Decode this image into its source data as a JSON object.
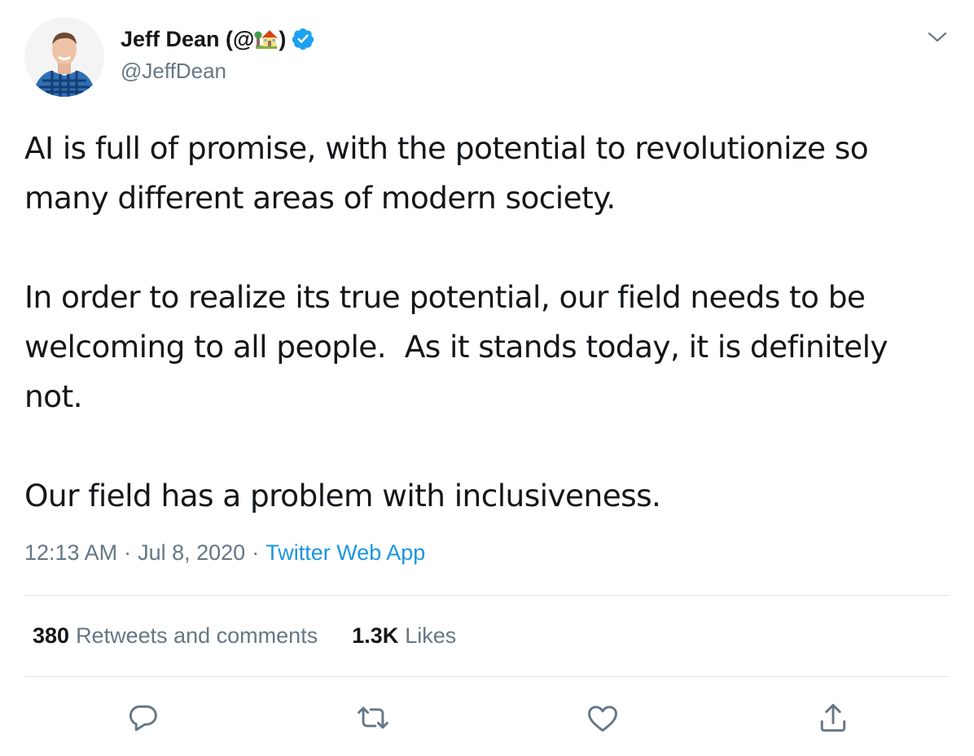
{
  "author": {
    "display_name_prefix": "Jeff Dean (@",
    "display_name_suffix": ")",
    "handle": "@JeffDean",
    "verified": true
  },
  "tweet": {
    "paragraphs": [
      "AI is full of promise, with the potential to revolutionize so many different areas of modern society.",
      "In order to realize its true potential, our field needs to be welcoming to all people.  As it stands today, it is definitely not.",
      "Our field has a problem with inclusiveness."
    ],
    "time": "12:13 AM",
    "date": "Jul 8, 2020",
    "separator": "·",
    "source": "Twitter Web App"
  },
  "stats": {
    "retweets_count": "380",
    "retweets_label": "Retweets and comments",
    "likes_count": "1.3K",
    "likes_label": "Likes"
  },
  "icons": {
    "verified": "verified-badge-icon",
    "caret": "chevron-down-icon",
    "reply": "reply-icon",
    "retweet": "retweet-icon",
    "like": "heart-icon",
    "share": "share-icon"
  },
  "colors": {
    "text": "#14171a",
    "secondary": "#657786",
    "link": "#1b95e0",
    "verified": "#1da1f2",
    "divider": "#e1e8ed"
  }
}
